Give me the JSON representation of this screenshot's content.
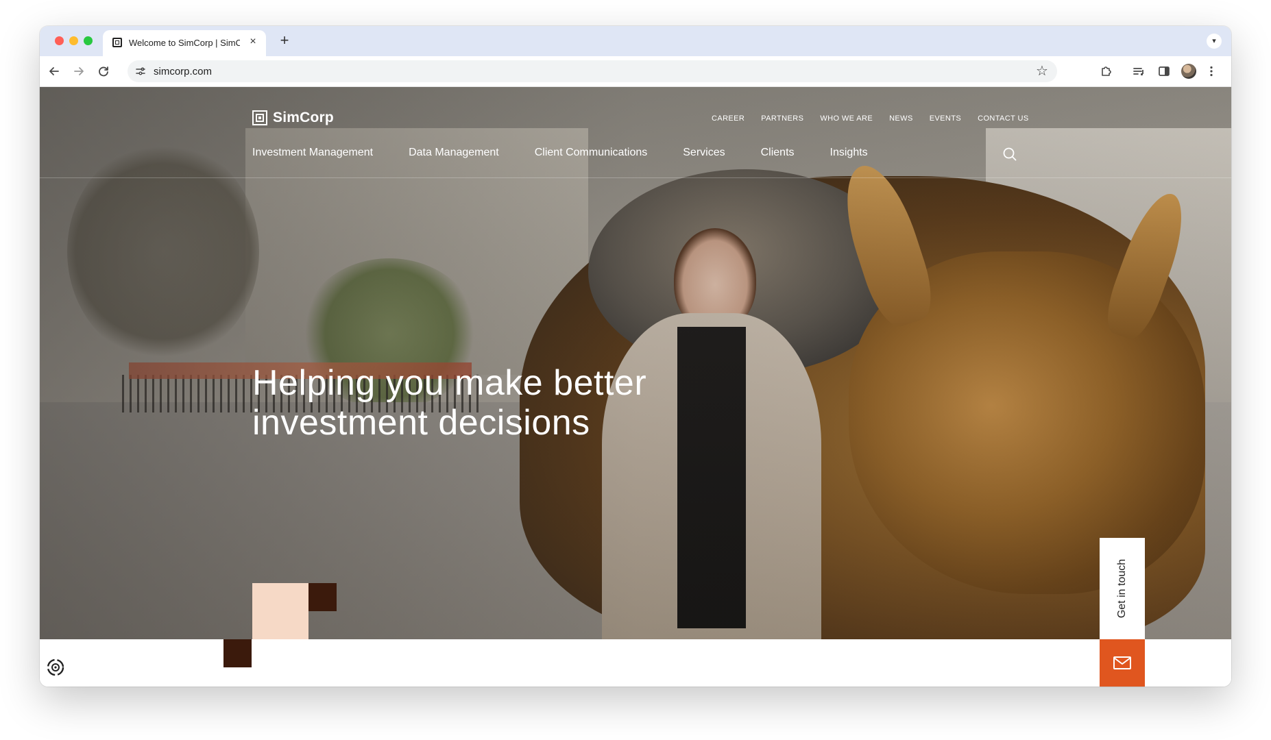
{
  "browser": {
    "tab_title": "Welcome to SimCorp | SimCorp",
    "tab_close": "×",
    "new_tab": "+",
    "url": "simcorp.com"
  },
  "site": {
    "logo_text": "SimCorp",
    "utility_nav": [
      "CAREER",
      "PARTNERS",
      "WHO WE ARE",
      "NEWS",
      "EVENTS",
      "CONTACT US"
    ],
    "main_nav": [
      "Investment Management",
      "Data Management",
      "Client Communications",
      "Services",
      "Clients",
      "Insights"
    ],
    "hero_title": "Helping you make better investment decisions",
    "get_in_touch": "Get in touch"
  },
  "colors": {
    "accent_orange": "#e0561f",
    "deco_peach": "#f6d9c6",
    "deco_brown": "#3b1a0c"
  }
}
